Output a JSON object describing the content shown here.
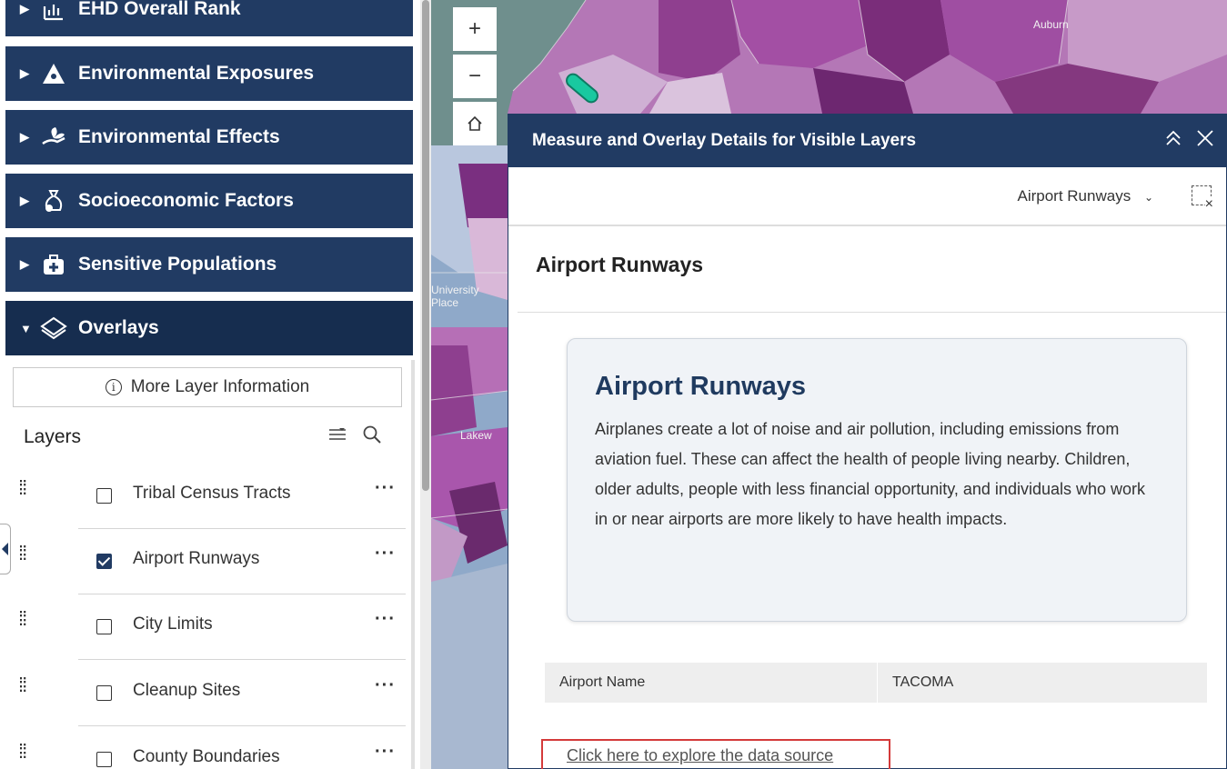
{
  "sidebar": {
    "categories": [
      {
        "label": "EHD Overall Rank",
        "icon": "rank-chart-icon",
        "expanded": false
      },
      {
        "label": "Environmental Exposures",
        "icon": "hazard-icon",
        "expanded": false
      },
      {
        "label": "Environmental Effects",
        "icon": "hand-plant-icon",
        "expanded": false
      },
      {
        "label": "Socioeconomic Factors",
        "icon": "money-bag-icon",
        "expanded": false
      },
      {
        "label": "Sensitive Populations",
        "icon": "medical-kit-icon",
        "expanded": false
      },
      {
        "label": "Overlays",
        "icon": "layers-icon",
        "expanded": true
      }
    ],
    "more_info_label": "More Layer Information",
    "layers_title": "Layers",
    "layers": [
      {
        "label": "Tribal Census Tracts",
        "checked": false
      },
      {
        "label": "Airport Runways",
        "checked": true
      },
      {
        "label": "City Limits",
        "checked": false
      },
      {
        "label": "Cleanup Sites",
        "checked": false
      },
      {
        "label": "County Boundaries",
        "checked": false
      }
    ],
    "more_glyph": "···"
  },
  "map": {
    "zoom_in": "+",
    "zoom_out": "−",
    "labels": {
      "auburn": "Auburn",
      "university_place": "University Place",
      "lakewood": "Lakew"
    }
  },
  "panel": {
    "header_title": "Measure and Overlay Details for Visible Layers",
    "selected_layer": "Airport Runways",
    "section_title": "Airport Runways",
    "card_title": "Airport Runways",
    "card_body": "Airplanes create a lot of noise and air pollution, including emissions from aviation fuel. These can affect the health of people living nearby. Children, older adults, people with less financial opportunity, and individuals who work in or near airports are more likely to have health impacts.",
    "attribute": {
      "key": "Airport Name",
      "value": "TACOMA"
    },
    "source_link": "Click here to explore the data source"
  },
  "colors": {
    "nav_bg": "#213b63",
    "nav_active_bg": "#162d4f",
    "highlight_border": "#d43a3a",
    "runway_feature": "#19c9a0"
  }
}
